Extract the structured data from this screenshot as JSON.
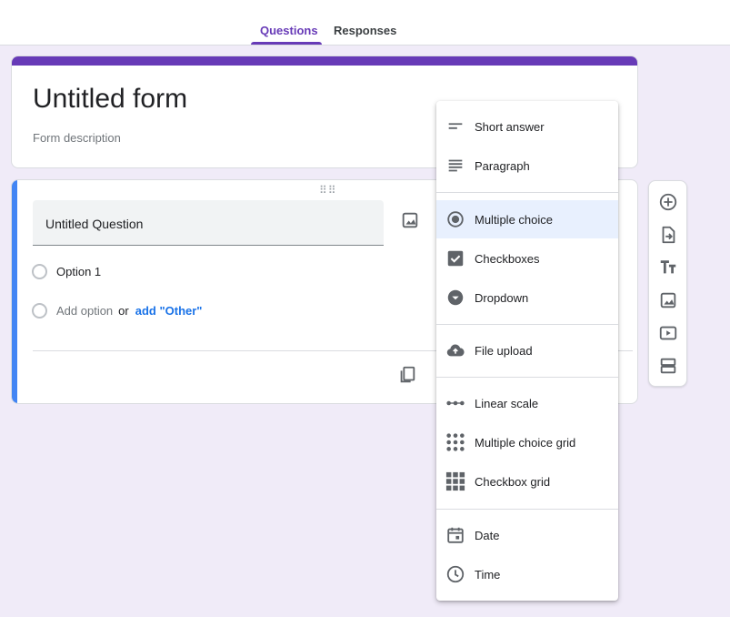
{
  "tabs": [
    {
      "label": "Questions",
      "active": true
    },
    {
      "label": "Responses",
      "active": false
    }
  ],
  "form": {
    "title": "Untitled form",
    "description_placeholder": "Form description"
  },
  "question": {
    "title": "Untitled Question",
    "options": [
      "Option 1"
    ],
    "add_option_label": "Add option",
    "or_label": "or",
    "add_other_label": "add \"Other\""
  },
  "type_menu": {
    "items": [
      {
        "label": "Short answer",
        "icon": "short-answer-icon"
      },
      {
        "label": "Paragraph",
        "icon": "paragraph-icon"
      },
      {
        "label": "Multiple choice",
        "icon": "radio-button-icon",
        "selected": true
      },
      {
        "label": "Checkboxes",
        "icon": "checkbox-icon"
      },
      {
        "label": "Dropdown",
        "icon": "dropdown-icon"
      },
      {
        "label": "File upload",
        "icon": "cloud-upload-icon"
      },
      {
        "label": "Linear scale",
        "icon": "linear-scale-icon"
      },
      {
        "label": "Multiple choice grid",
        "icon": "dot-grid-icon"
      },
      {
        "label": "Checkbox grid",
        "icon": "square-grid-icon"
      },
      {
        "label": "Date",
        "icon": "calendar-icon"
      },
      {
        "label": "Time",
        "icon": "clock-icon"
      }
    ]
  },
  "side_toolbar": {
    "buttons": [
      "add-question-icon",
      "import-questions-icon",
      "add-title-icon",
      "add-image-icon",
      "add-video-icon",
      "add-section-icon"
    ]
  },
  "colors": {
    "accent": "#673ab7",
    "question_border": "#4285f4",
    "link": "#1a73e8",
    "background": "#f0ebf8",
    "selected_item": "#e8f0fe"
  }
}
